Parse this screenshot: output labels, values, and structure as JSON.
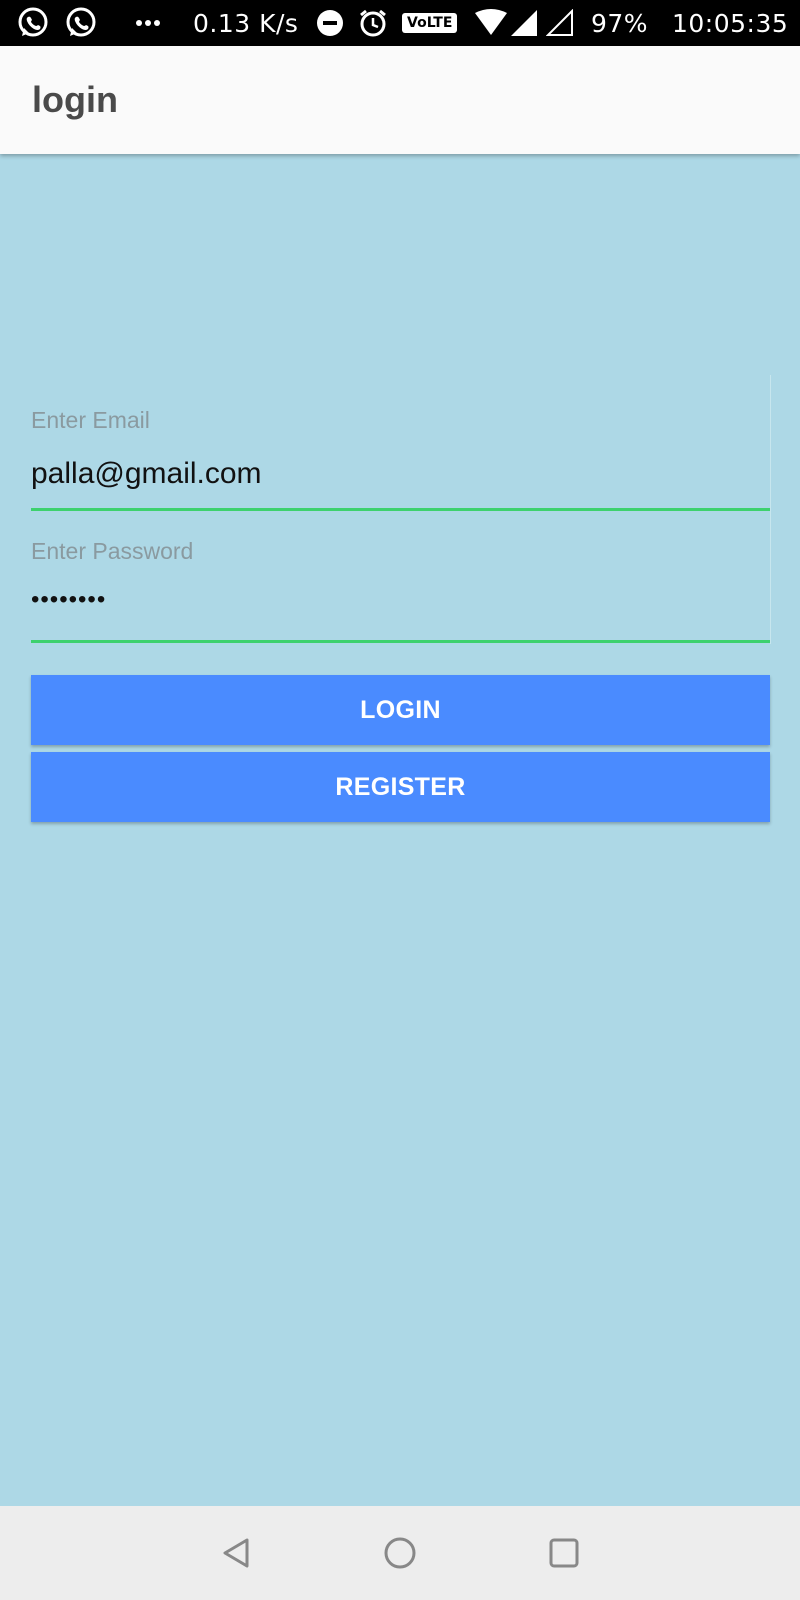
{
  "status_bar": {
    "net_speed": "0.13 K/s",
    "volte": "VoLTE",
    "battery": "97%",
    "time": "10:05:35",
    "icons": [
      "whatsapp-icon",
      "whatsapp-icon",
      "more-icon",
      "dnd-icon",
      "alarm-icon",
      "volte-icon",
      "wifi-icon",
      "signal-icon",
      "signal-empty-icon"
    ]
  },
  "app_bar": {
    "title": "login"
  },
  "form": {
    "email": {
      "label": "Enter Email",
      "value": "palla@gmail.com"
    },
    "password": {
      "label": "Enter Password",
      "value": "••••••••"
    },
    "login_label": "LOGIN",
    "register_label": "REGISTER"
  },
  "nav_bar": {
    "icons": [
      "back-icon",
      "home-icon",
      "recents-icon"
    ]
  },
  "colors": {
    "background": "#ADD8E6",
    "button": "#4A8BFF",
    "underline": "#3DD16E",
    "app_bar": "#FAFAFA"
  }
}
